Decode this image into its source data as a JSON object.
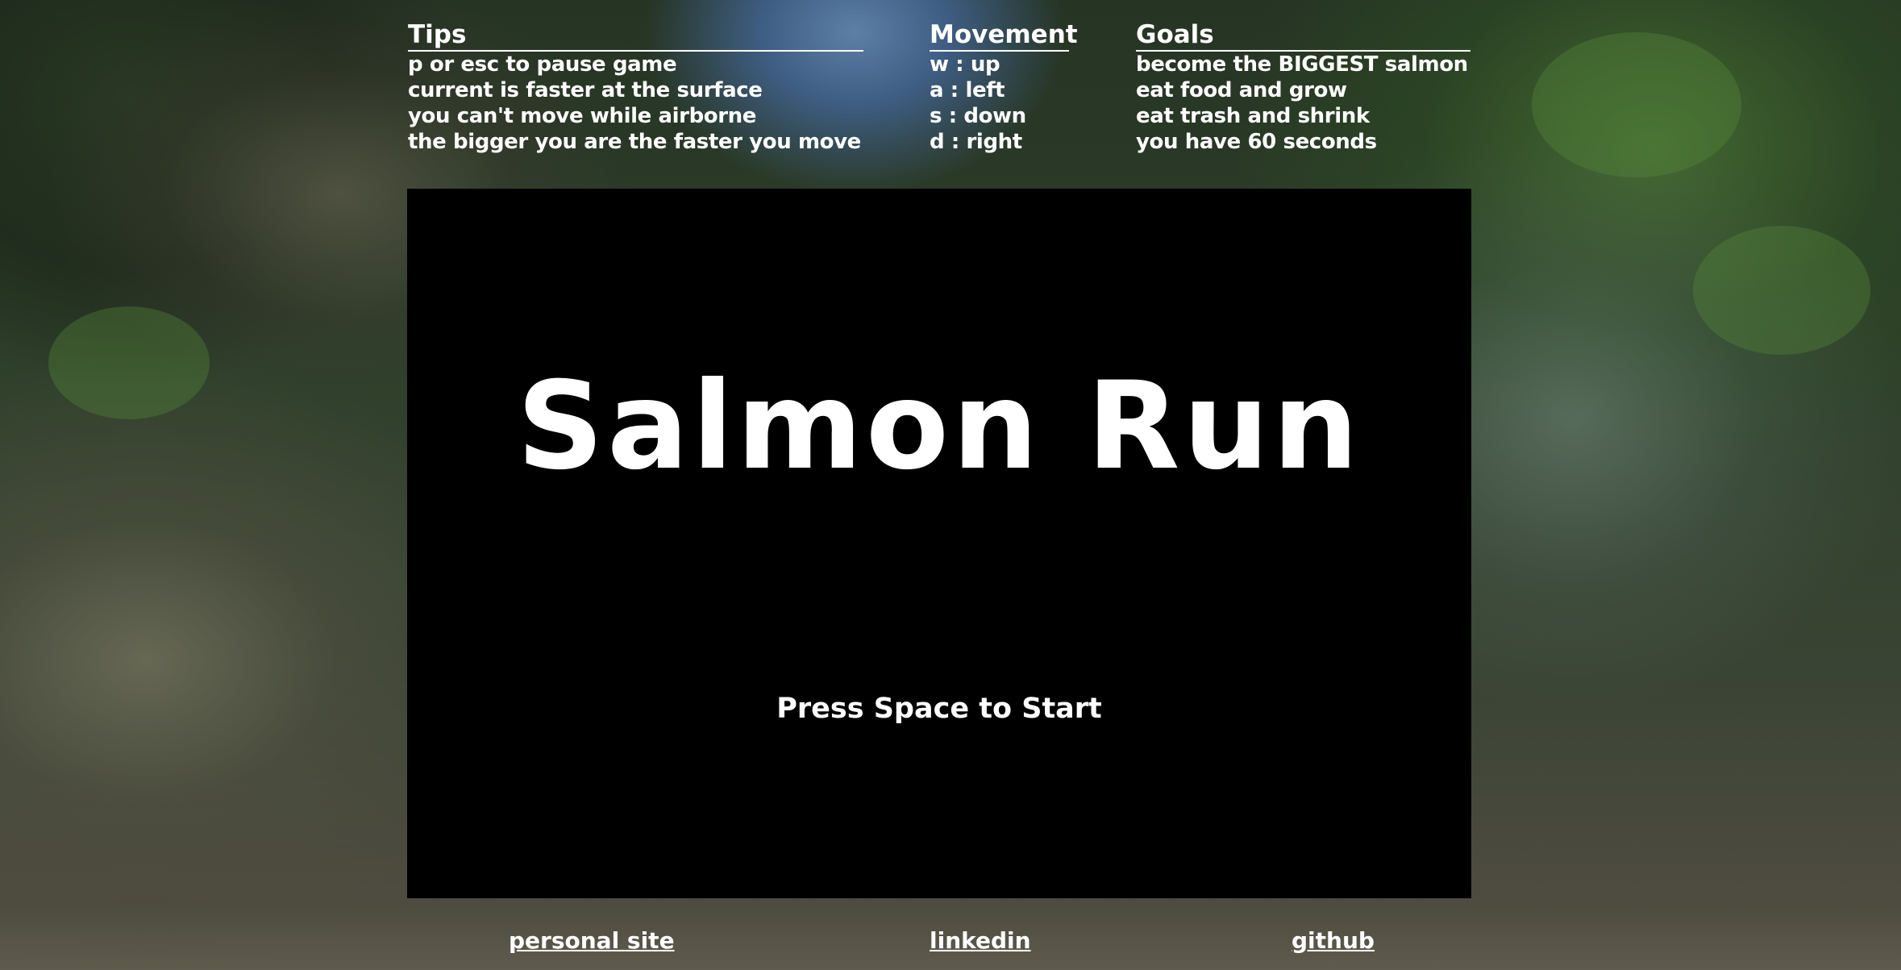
{
  "tips": {
    "heading": "Tips",
    "items": [
      "p or esc to pause game",
      "current is faster at the surface",
      "you can't move while airborne",
      "the bigger you are the faster you move"
    ]
  },
  "movement": {
    "heading": "Movement",
    "items": [
      "w : up",
      "a : left",
      "s : down",
      "d : right"
    ]
  },
  "goals": {
    "heading": "Goals",
    "items": [
      "become the BIGGEST salmon",
      "eat food and grow",
      "eat trash and shrink",
      "you have 60 seconds"
    ]
  },
  "game": {
    "title": "Salmon Run",
    "prompt": "Press Space to Start"
  },
  "footer": {
    "links": [
      "personal site",
      "linkedin",
      "github"
    ]
  },
  "colors": {
    "text": "#ffffff",
    "canvas": "#000000"
  }
}
